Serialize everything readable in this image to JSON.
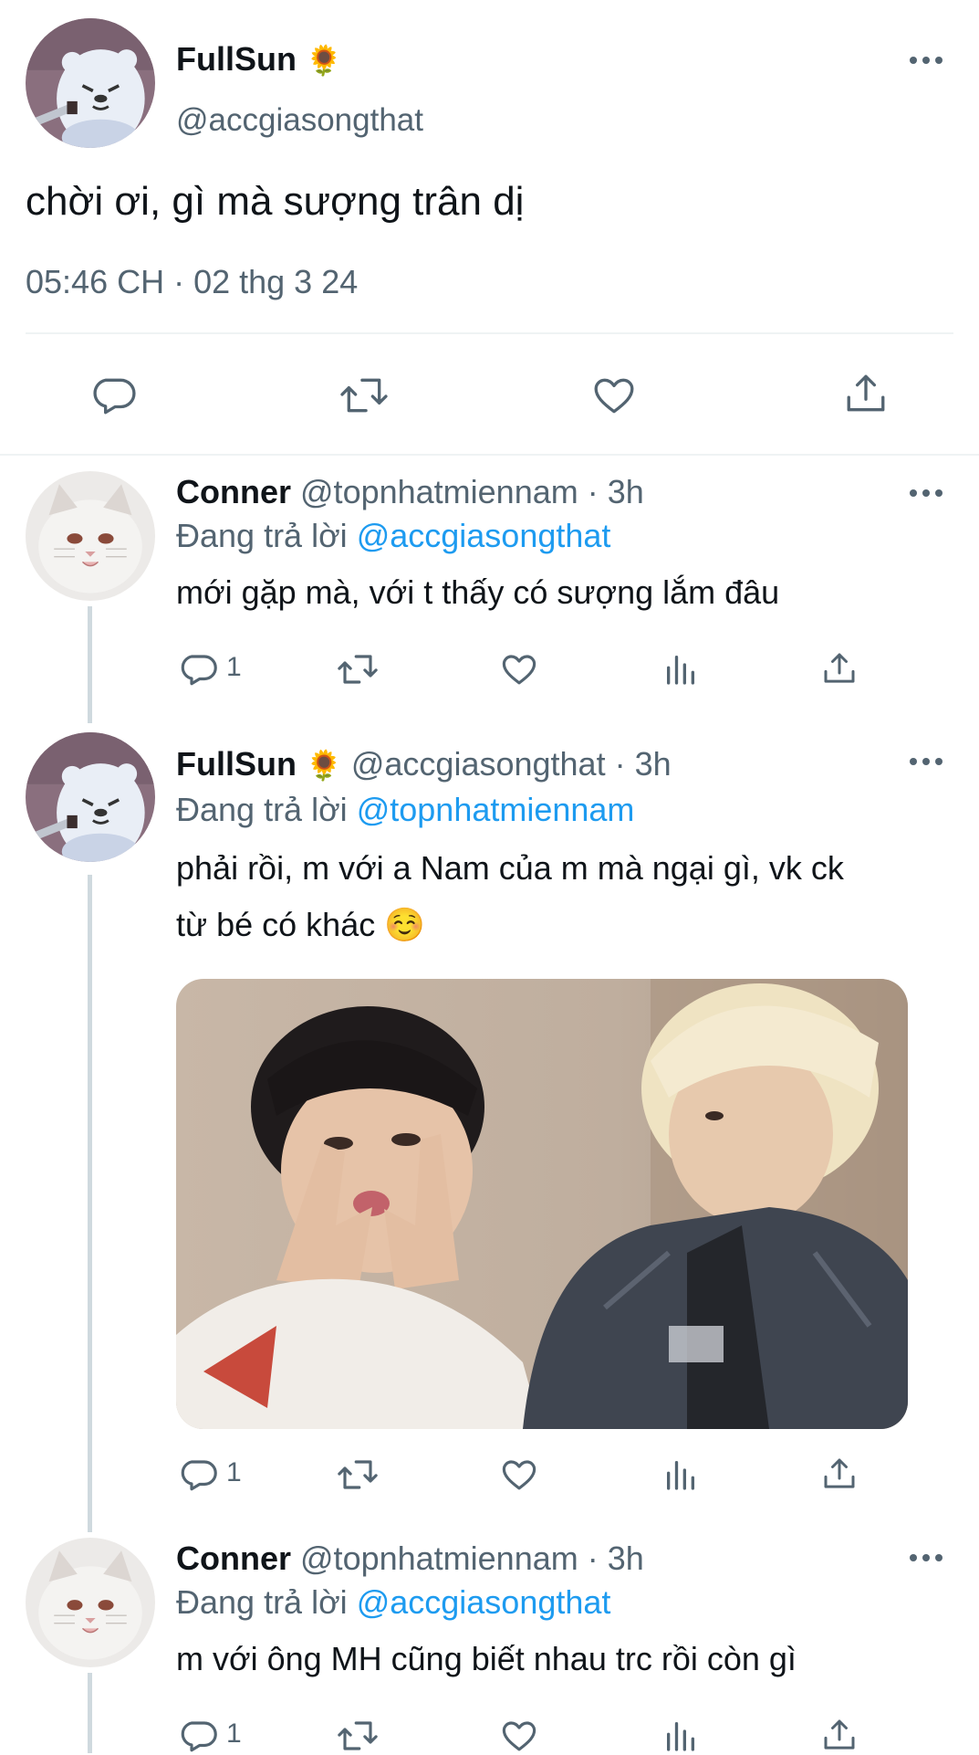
{
  "main_tweet": {
    "display_name": "FullSun",
    "name_emoji": "🌻",
    "handle": "@accgiasongthat",
    "text": "chời ơi, gì mà sượng trân dị",
    "timestamp": "05:46 CH · 02 thg 3 24"
  },
  "replies": [
    {
      "display_name": "Conner",
      "handle": "@topnhatmiennam",
      "time": "· 3h",
      "replying_prefix": "Đang trả lời",
      "replying_to": "@accgiasongthat",
      "text": "mới gặp mà, với t thấy có sượng lắm đâu",
      "reply_count": "1"
    },
    {
      "display_name": "FullSun",
      "name_emoji": "🌻",
      "handle": "@accgiasongthat",
      "time": "· 3h",
      "replying_prefix": "Đang trả lời",
      "replying_to": "@topnhatmiennam",
      "text_line1": "phải rồi, m với a Nam của m mà ngại gì, vk ck",
      "text_line2": "từ bé có khác",
      "text_emoji": "☺️",
      "reply_count": "1"
    },
    {
      "display_name": "Conner",
      "handle": "@topnhatmiennam",
      "time": "· 3h",
      "replying_prefix": "Đang trả lời",
      "replying_to": "@accgiasongthat",
      "text": "m với ông MH cũng biết nhau trc rồi còn gì",
      "reply_count": "1"
    }
  ],
  "colors": {
    "accent": "#1d9bf0",
    "secondary_text": "#536471",
    "icon": "#536471",
    "divider": "#eff3f4",
    "thread_line": "#cfd9de"
  }
}
